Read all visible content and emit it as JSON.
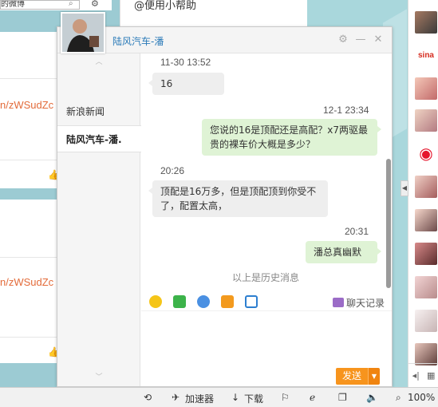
{
  "background": {
    "search_placeholder": "的微博",
    "link_text_1": "n/zWSudZc",
    "link_text_2": "n/zWSudZc",
    "center_text": "@便用小帮助"
  },
  "chat": {
    "title": "陆风汽车-潘",
    "sidebar": {
      "items": [
        {
          "label": "新浪新闻",
          "active": false
        },
        {
          "label": "陆风汽车-潘.",
          "active": true
        }
      ]
    },
    "messages": [
      {
        "time": "11-30 13:52",
        "side": "in",
        "text": "16"
      },
      {
        "time": "12-1 23:34",
        "side": "out",
        "text": "您说的16是顶配还是高配？x7两驱最贵的裸车价大概是多少？"
      },
      {
        "time": "20:26",
        "side": "in",
        "text": "顶配是16万多，但是顶配顶到你受不了，配置太高，"
      },
      {
        "time": "20:31",
        "side": "out",
        "text": "潘总真幽默"
      }
    ],
    "history_notice": "以上是历史消息",
    "toolbar": {
      "history_label": "聊天记录",
      "tools": [
        "emoji-icon",
        "image-icon",
        "attachment-icon",
        "app-icon",
        "screenshot-icon"
      ]
    },
    "send_label": "发送"
  },
  "statusbar": {
    "accelerator": "加速器",
    "download": "下载",
    "zoom": "100%"
  },
  "colors": {
    "accent_blue": "#2a7ab8",
    "send_orange": "#f7941d",
    "bubble_out": "#dff3d5",
    "bubble_in": "#eeeeee"
  }
}
